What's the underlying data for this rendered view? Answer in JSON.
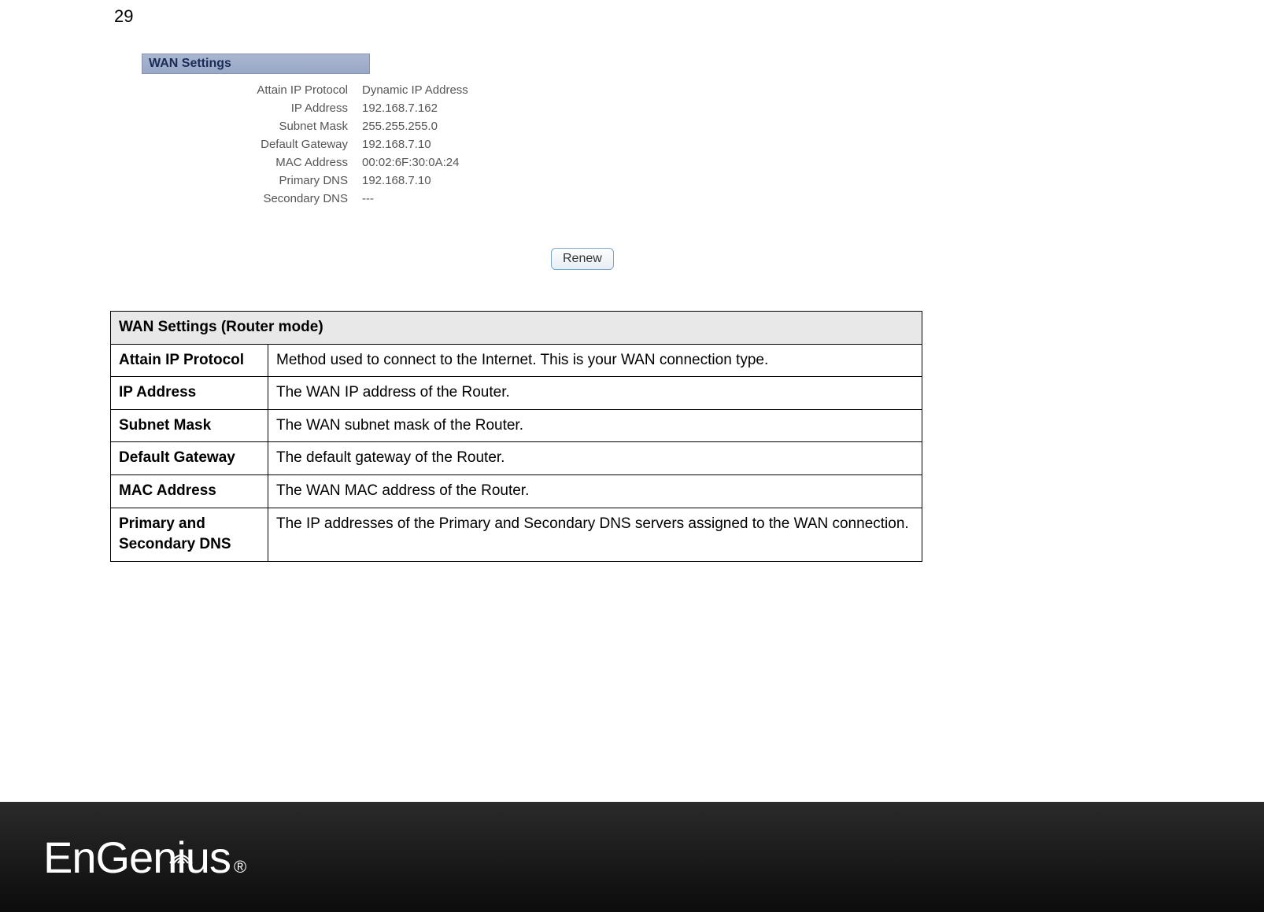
{
  "page_number": "29",
  "wan_panel": {
    "title": "WAN Settings",
    "fields": [
      {
        "label": "Attain IP Protocol",
        "value": "Dynamic IP Address"
      },
      {
        "label": "IP Address",
        "value": "192.168.7.162"
      },
      {
        "label": "Subnet Mask",
        "value": "255.255.255.0"
      },
      {
        "label": "Default Gateway",
        "value": "192.168.7.10"
      },
      {
        "label": "MAC Address",
        "value": "00:02:6F:30:0A:24"
      },
      {
        "label": "Primary DNS",
        "value": "192.168.7.10"
      },
      {
        "label": "Secondary DNS",
        "value": "---"
      }
    ],
    "renew_button": "Renew"
  },
  "desc_table": {
    "header": "WAN Settings (Router mode)",
    "rows": [
      {
        "term": "Attain IP Protocol",
        "def": "Method used to connect to the Internet. This is your WAN connection type."
      },
      {
        "term": "IP Address",
        "def": "The WAN IP address of the Router."
      },
      {
        "term": "Subnet Mask",
        "def": "The WAN subnet mask of the Router."
      },
      {
        "term": "Default Gateway",
        "def": "The default gateway of the Router."
      },
      {
        "term": "MAC Address",
        "def": "The WAN MAC address of the Router."
      },
      {
        "term": "Primary and Secondary DNS",
        "def": "The IP addresses of the Primary and Secondary DNS servers assigned to the WAN connection."
      }
    ]
  },
  "footer": {
    "brand_prefix": "EnGen",
    "brand_i": "i",
    "brand_suffix": "us",
    "registered": "®"
  }
}
